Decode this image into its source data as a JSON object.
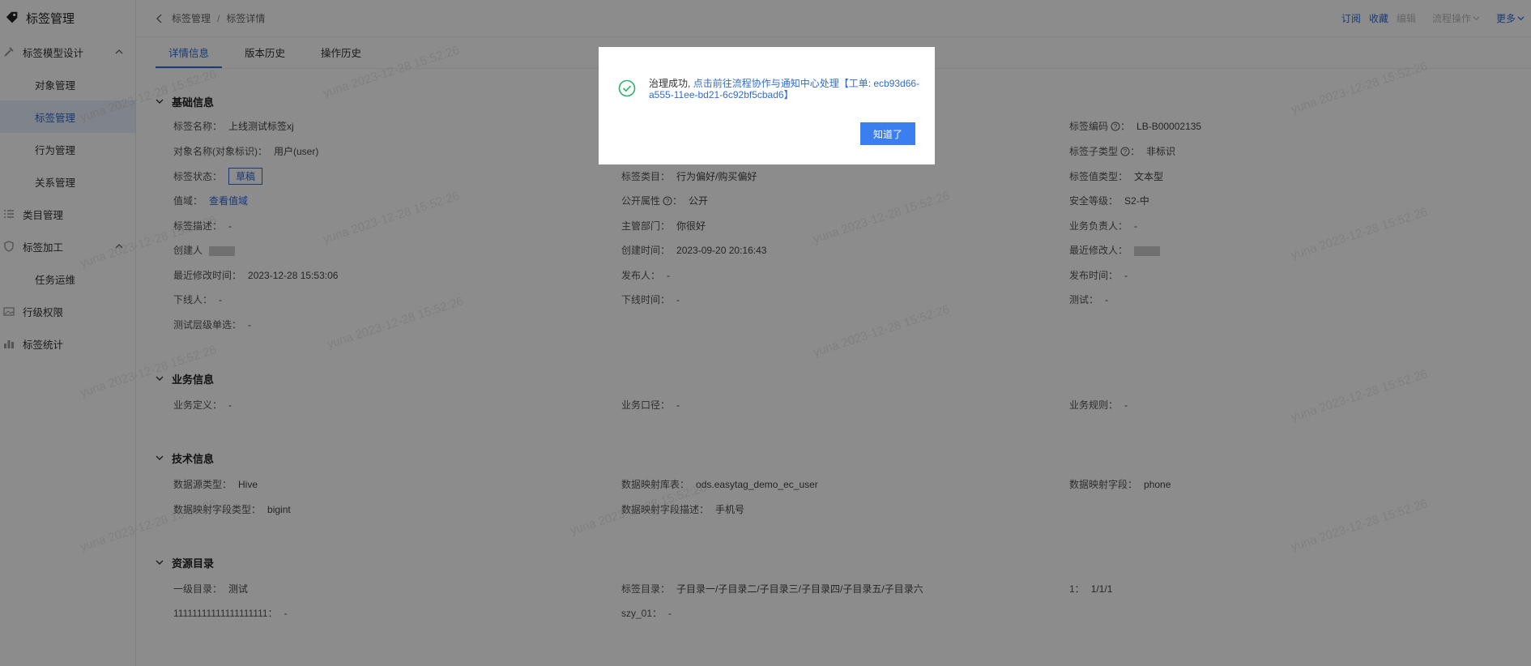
{
  "sidebar": {
    "brand": "标签管理",
    "items": [
      {
        "label": "标签模型设计"
      },
      {
        "label": "对象管理"
      },
      {
        "label": "标签管理"
      },
      {
        "label": "行为管理"
      },
      {
        "label": "关系管理"
      },
      {
        "label": "类目管理"
      },
      {
        "label": "标签加工"
      },
      {
        "label": "任务运维"
      },
      {
        "label": "行级权限"
      },
      {
        "label": "标签统计"
      }
    ]
  },
  "header": {
    "breadcrumb": [
      "标签管理",
      "标签详情"
    ],
    "separator": "/",
    "actions": {
      "subscribe": "订阅",
      "favorite": "收藏",
      "edit": "编辑",
      "flow": "流程操作",
      "more": "更多"
    }
  },
  "tabs": [
    "详情信息",
    "版本历史",
    "操作历史"
  ],
  "sections": {
    "basic": {
      "title": "基础信息",
      "fields": {
        "name": {
          "label": "标签名称：",
          "value": "上线测试标签xj"
        },
        "code": {
          "label": "标签编码",
          "value": "LB-B00002135"
        },
        "object": {
          "label": "对象名称(对象标识)：",
          "value": "用户(user)"
        },
        "subtype": {
          "label": "标签子类型",
          "value": "非标识"
        },
        "status": {
          "label": "标签状态：",
          "value": "草稿"
        },
        "category": {
          "label": "标签类目：",
          "value": "行为偏好/购买偏好"
        },
        "valuetype": {
          "label": "标签值类型：",
          "value": "文本型"
        },
        "domain": {
          "label": "值域：",
          "value": "查看值域"
        },
        "public": {
          "label": "公开属性",
          "value": "公开"
        },
        "security": {
          "label": "安全等级：",
          "value": "S2-中"
        },
        "desc": {
          "label": "标签描述：",
          "value": "-"
        },
        "dept": {
          "label": "主管部门：",
          "value": "你很好"
        },
        "owner": {
          "label": "业务负责人：",
          "value": "-"
        },
        "creator": {
          "label": "创建人"
        },
        "created": {
          "label": "创建时间：",
          "value": "2023-09-20 20:16:43"
        },
        "modifier": {
          "label": "最近修改人："
        },
        "modified": {
          "label": "最近修改时间：",
          "value": "2023-12-28 15:53:06"
        },
        "publisher": {
          "label": "发布人：",
          "value": "-"
        },
        "published": {
          "label": "发布时间：",
          "value": "-"
        },
        "offliner": {
          "label": "下线人：",
          "value": "-"
        },
        "offlined": {
          "label": "下线时间：",
          "value": "-"
        },
        "test": {
          "label": "测试：",
          "value": "-"
        },
        "testlevel": {
          "label": "测试层级单选：",
          "value": "-"
        }
      }
    },
    "business": {
      "title": "业务信息",
      "fields": {
        "def": {
          "label": "业务定义：",
          "value": "-"
        },
        "caliber": {
          "label": "业务口径：",
          "value": "-"
        },
        "rule": {
          "label": "业务规则：",
          "value": "-"
        }
      }
    },
    "tech": {
      "title": "技术信息",
      "fields": {
        "srctype": {
          "label": "数据源类型：",
          "value": "Hive"
        },
        "table": {
          "label": "数据映射库表：",
          "value": "ods.easytag_demo_ec_user"
        },
        "field": {
          "label": "数据映射字段：",
          "value": "phone"
        },
        "fieldtype": {
          "label": "数据映射字段类型：",
          "value": "bigint"
        },
        "fielddesc": {
          "label": "数据映射字段描述：",
          "value": "手机号"
        }
      }
    },
    "resource": {
      "title": "资源目录",
      "fields": {
        "level1": {
          "label": "一级目录：",
          "value": "测试"
        },
        "tagdir": {
          "label": "标签目录：",
          "value": "子目录一/子目录二/子目录三/子目录四/子目录五/子目录六"
        },
        "one": {
          "label": "1：",
          "value": "1/1/1"
        },
        "ones": {
          "label": "11111111111111111111：",
          "value": "-"
        },
        "szy": {
          "label": "szy_01：",
          "value": "-"
        }
      }
    }
  },
  "watermark": "yuna 2023-12-28 15:52:26",
  "modal": {
    "message": "治理成功,",
    "link": "点击前往流程协作与通知中心处理【工单: ecb93d66-a555-11ee-bd21-6c92bf5cbad6】",
    "button": "知道了"
  },
  "colors": {
    "accent": "#2f6bd8",
    "success": "#2bb36b",
    "button": "#3a7ef0"
  }
}
